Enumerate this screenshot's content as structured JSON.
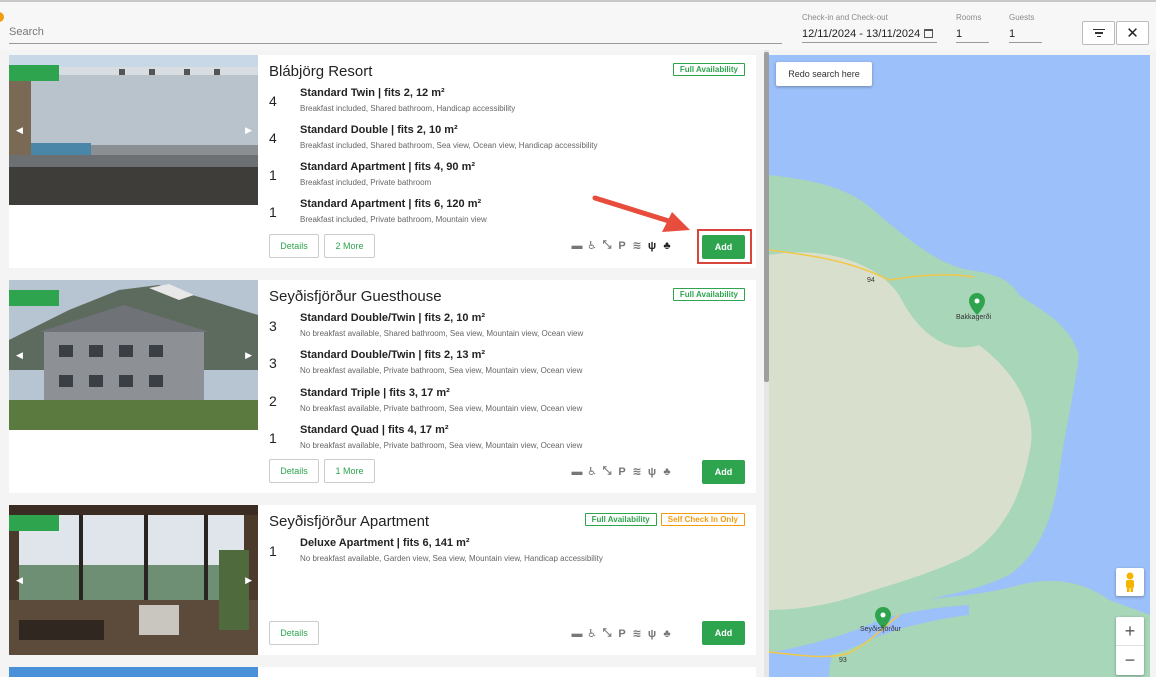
{
  "search": {
    "placeholder": "Search"
  },
  "dates": {
    "label": "Check-in and Check-out",
    "value": "12/11/2024 - 13/11/2024"
  },
  "rooms": {
    "label": "Rooms",
    "value": "1"
  },
  "guests": {
    "label": "Guests",
    "value": "1"
  },
  "listings": [
    {
      "title": "Blábjörg Resort",
      "badges": [
        "Full Availability"
      ],
      "rooms": [
        {
          "count": "4",
          "name": "Standard Twin | fits 2, 12 m²",
          "features": "Breakfast included, Shared bathroom, Handicap accessibility"
        },
        {
          "count": "4",
          "name": "Standard Double | fits 2, 10 m²",
          "features": "Breakfast included, Shared bathroom, Sea view, Ocean view, Handicap accessibility"
        },
        {
          "count": "1",
          "name": "Standard Apartment | fits 4, 90 m²",
          "features": "Breakfast included, Private bathroom"
        },
        {
          "count": "1",
          "name": "Standard Apartment | fits 6, 120 m²",
          "features": "Breakfast included, Private bathroom, Mountain view"
        }
      ],
      "details_label": "Details",
      "more_label": "2 More",
      "add_label": "Add"
    },
    {
      "title": "Seyðisfjörður Guesthouse",
      "badges": [
        "Full Availability"
      ],
      "rooms": [
        {
          "count": "3",
          "name": "Standard Double/Twin | fits 2, 10 m²",
          "features": "No breakfast available, Shared bathroom, Sea view, Mountain view, Ocean view"
        },
        {
          "count": "3",
          "name": "Standard Double/Twin | fits 2, 13 m²",
          "features": "No breakfast available, Private bathroom, Sea view, Mountain view, Ocean view"
        },
        {
          "count": "2",
          "name": "Standard Triple | fits 3, 17 m²",
          "features": "No breakfast available, Private bathroom, Sea view, Mountain view, Ocean view"
        },
        {
          "count": "1",
          "name": "Standard Quad | fits 4, 17 m²",
          "features": "No breakfast available, Private bathroom, Sea view, Mountain view, Ocean view"
        }
      ],
      "details_label": "Details",
      "more_label": "1 More",
      "add_label": "Add"
    },
    {
      "title": "Seyðisfjörður Apartment",
      "badges": [
        "Full Availability",
        "Self Check In Only"
      ],
      "rooms": [
        {
          "count": "1",
          "name": "Deluxe Apartment | fits 6, 141 m²",
          "features": "No breakfast available, Garden view, Sea view, Mountain view, Handicap accessibility"
        }
      ],
      "details_label": "Details",
      "add_label": "Add"
    }
  ],
  "amenity_icons": [
    "luggage-icon",
    "wheelchair-icon",
    "resize-icon",
    "parking-icon",
    "wifi-icon",
    "restaurant-icon",
    "spa-icon"
  ],
  "map": {
    "redo_label": "Redo search here",
    "places": {
      "bakkagerdi": "Bakkagerði",
      "seydisfjordur": "Seyðisfjörður"
    },
    "roads": {
      "r94": "94",
      "r93": "93"
    },
    "zoom_in": "+",
    "zoom_out": "−"
  },
  "colors": {
    "accent": "#2ea44f",
    "highlight": "#d9443b",
    "arrow": "#e74c3c",
    "warning": "#f39c12"
  }
}
